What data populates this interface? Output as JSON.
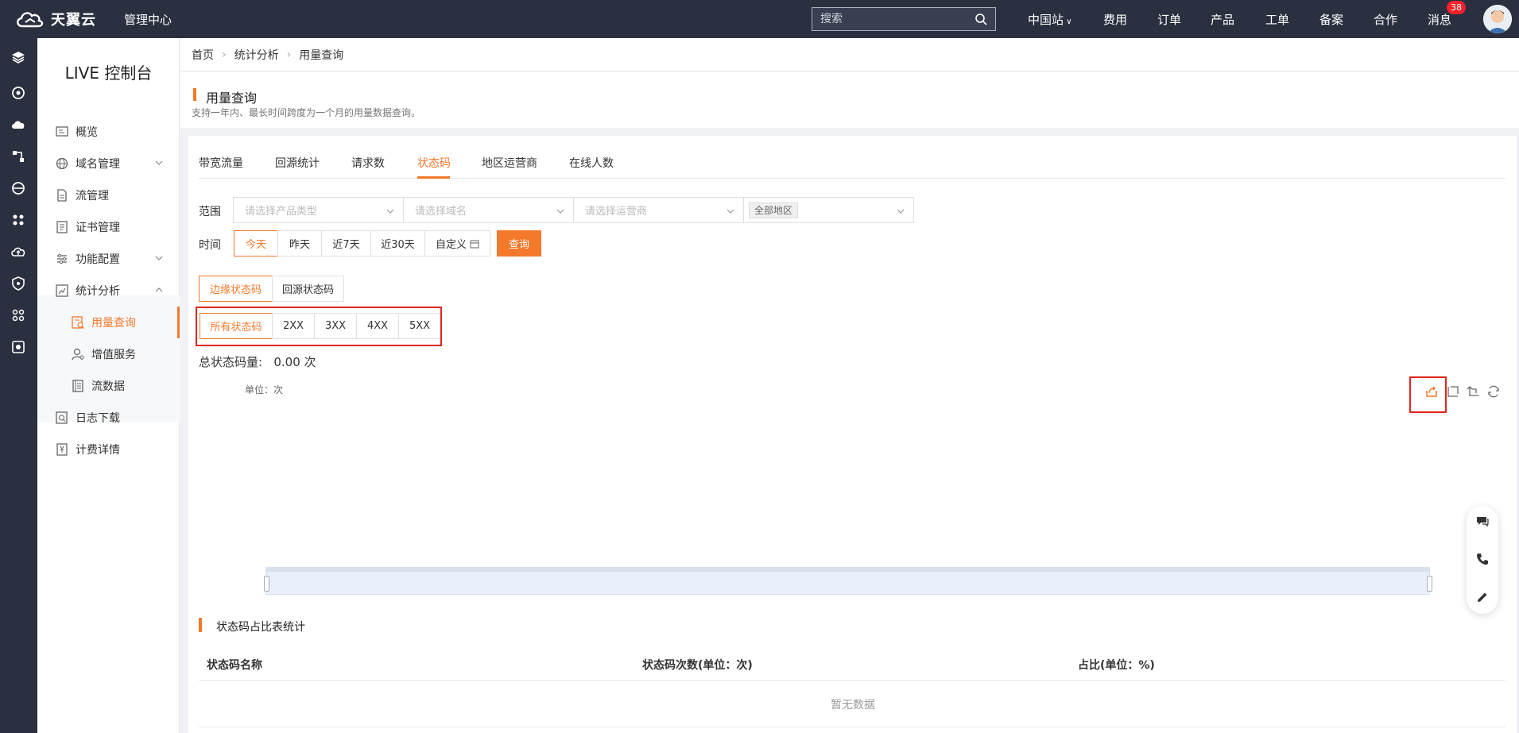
{
  "topbar": {
    "brand": "天翼云",
    "mgmt": "管理中心",
    "search_placeholder": "搜索",
    "nav": [
      "中国站",
      "费用",
      "订单",
      "产品",
      "工单",
      "备案",
      "合作",
      "消息"
    ],
    "badge": "38"
  },
  "sidebar": {
    "title": "LIVE 控制台",
    "items": [
      {
        "label": "概览",
        "icon": "overview-icon"
      },
      {
        "label": "域名管理",
        "icon": "domain-icon"
      },
      {
        "label": "流管理",
        "icon": "stream-icon"
      },
      {
        "label": "证书管理",
        "icon": "certificate-icon"
      },
      {
        "label": "功能配置",
        "icon": "config-icon"
      },
      {
        "label": "统计分析",
        "icon": "stats-icon"
      },
      {
        "label": "用量查询",
        "icon": "usage-icon"
      },
      {
        "label": "增值服务",
        "icon": "user-service-icon"
      },
      {
        "label": "流数据",
        "icon": "stream-data-icon"
      },
      {
        "label": "日志下载",
        "icon": "log-icon"
      },
      {
        "label": "计费详情",
        "icon": "billing-icon"
      }
    ]
  },
  "breadcrumb": [
    "首页",
    "统计分析",
    "用量查询"
  ],
  "header": {
    "title": "用量查询",
    "desc": "支持一年内、最长时间跨度为一个月的用量数据查询。"
  },
  "tabs": [
    "带宽流量",
    "回源统计",
    "请求数",
    "状态码",
    "地区运营商",
    "在线人数"
  ],
  "filters": {
    "range_label": "范围",
    "time_label": "时间",
    "product_placeholder": "请选择产品类型",
    "domain_placeholder": "请选择域名",
    "isp_placeholder": "请选择运营商",
    "region_tag": "全部地区",
    "time_buttons": [
      "今天",
      "昨天",
      "近7天",
      "近30天",
      "自定义"
    ],
    "query": "查询"
  },
  "code_source": [
    "边缘状态码",
    "回源状态码"
  ],
  "code_types": [
    "所有状态码",
    "2XX",
    "3XX",
    "4XX",
    "5XX"
  ],
  "summary": {
    "label": "总状态码量:",
    "value": "0.00 次"
  },
  "chart": {
    "unit": "单位：次"
  },
  "table": {
    "title": "状态码占比表统计",
    "headers": [
      "状态码名称",
      "状态码次数(单位：次)",
      "占比(单位：%)"
    ],
    "empty": "暂无数据"
  },
  "colors": {
    "accent": "#f5792a",
    "topbar": "#2b3040",
    "highlight": "#e1251b"
  }
}
